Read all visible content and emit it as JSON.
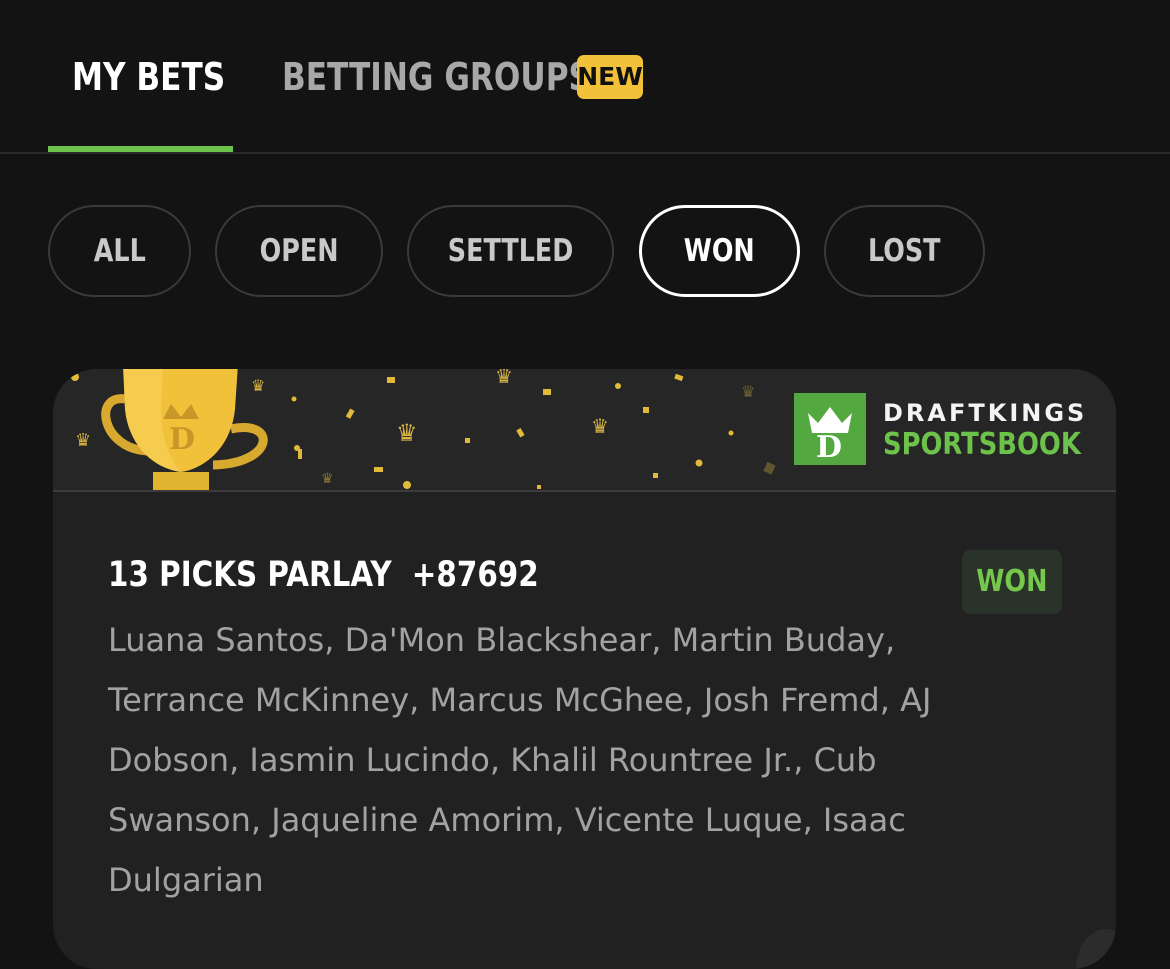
{
  "tabs": {
    "my_bets": "MY BETS",
    "betting_groups": "BETTING GROUPS",
    "new_badge": "NEW"
  },
  "filters": [
    "ALL",
    "OPEN",
    "SETTLED",
    "WON",
    "LOST"
  ],
  "selected_filter": "WON",
  "brand": {
    "top": "DRAFTKINGS",
    "bottom": "SPORTSBOOK",
    "accent": "#6cc24a",
    "gold": "#f2c13a"
  },
  "bet": {
    "title": "13 PICKS PARLAY",
    "odds": "+87692",
    "status": "WON",
    "picks": "Luana Santos, Da'Mon Blackshear, Martin Buday, Terrance McKinney, Marcus McGhee, Josh Fremd, AJ Dobson, Iasmin Lucindo, Khalil Rountree Jr., Cub Swanson, Jaqueline Amorim, Vicente Luque, Isaac Dulgarian"
  }
}
